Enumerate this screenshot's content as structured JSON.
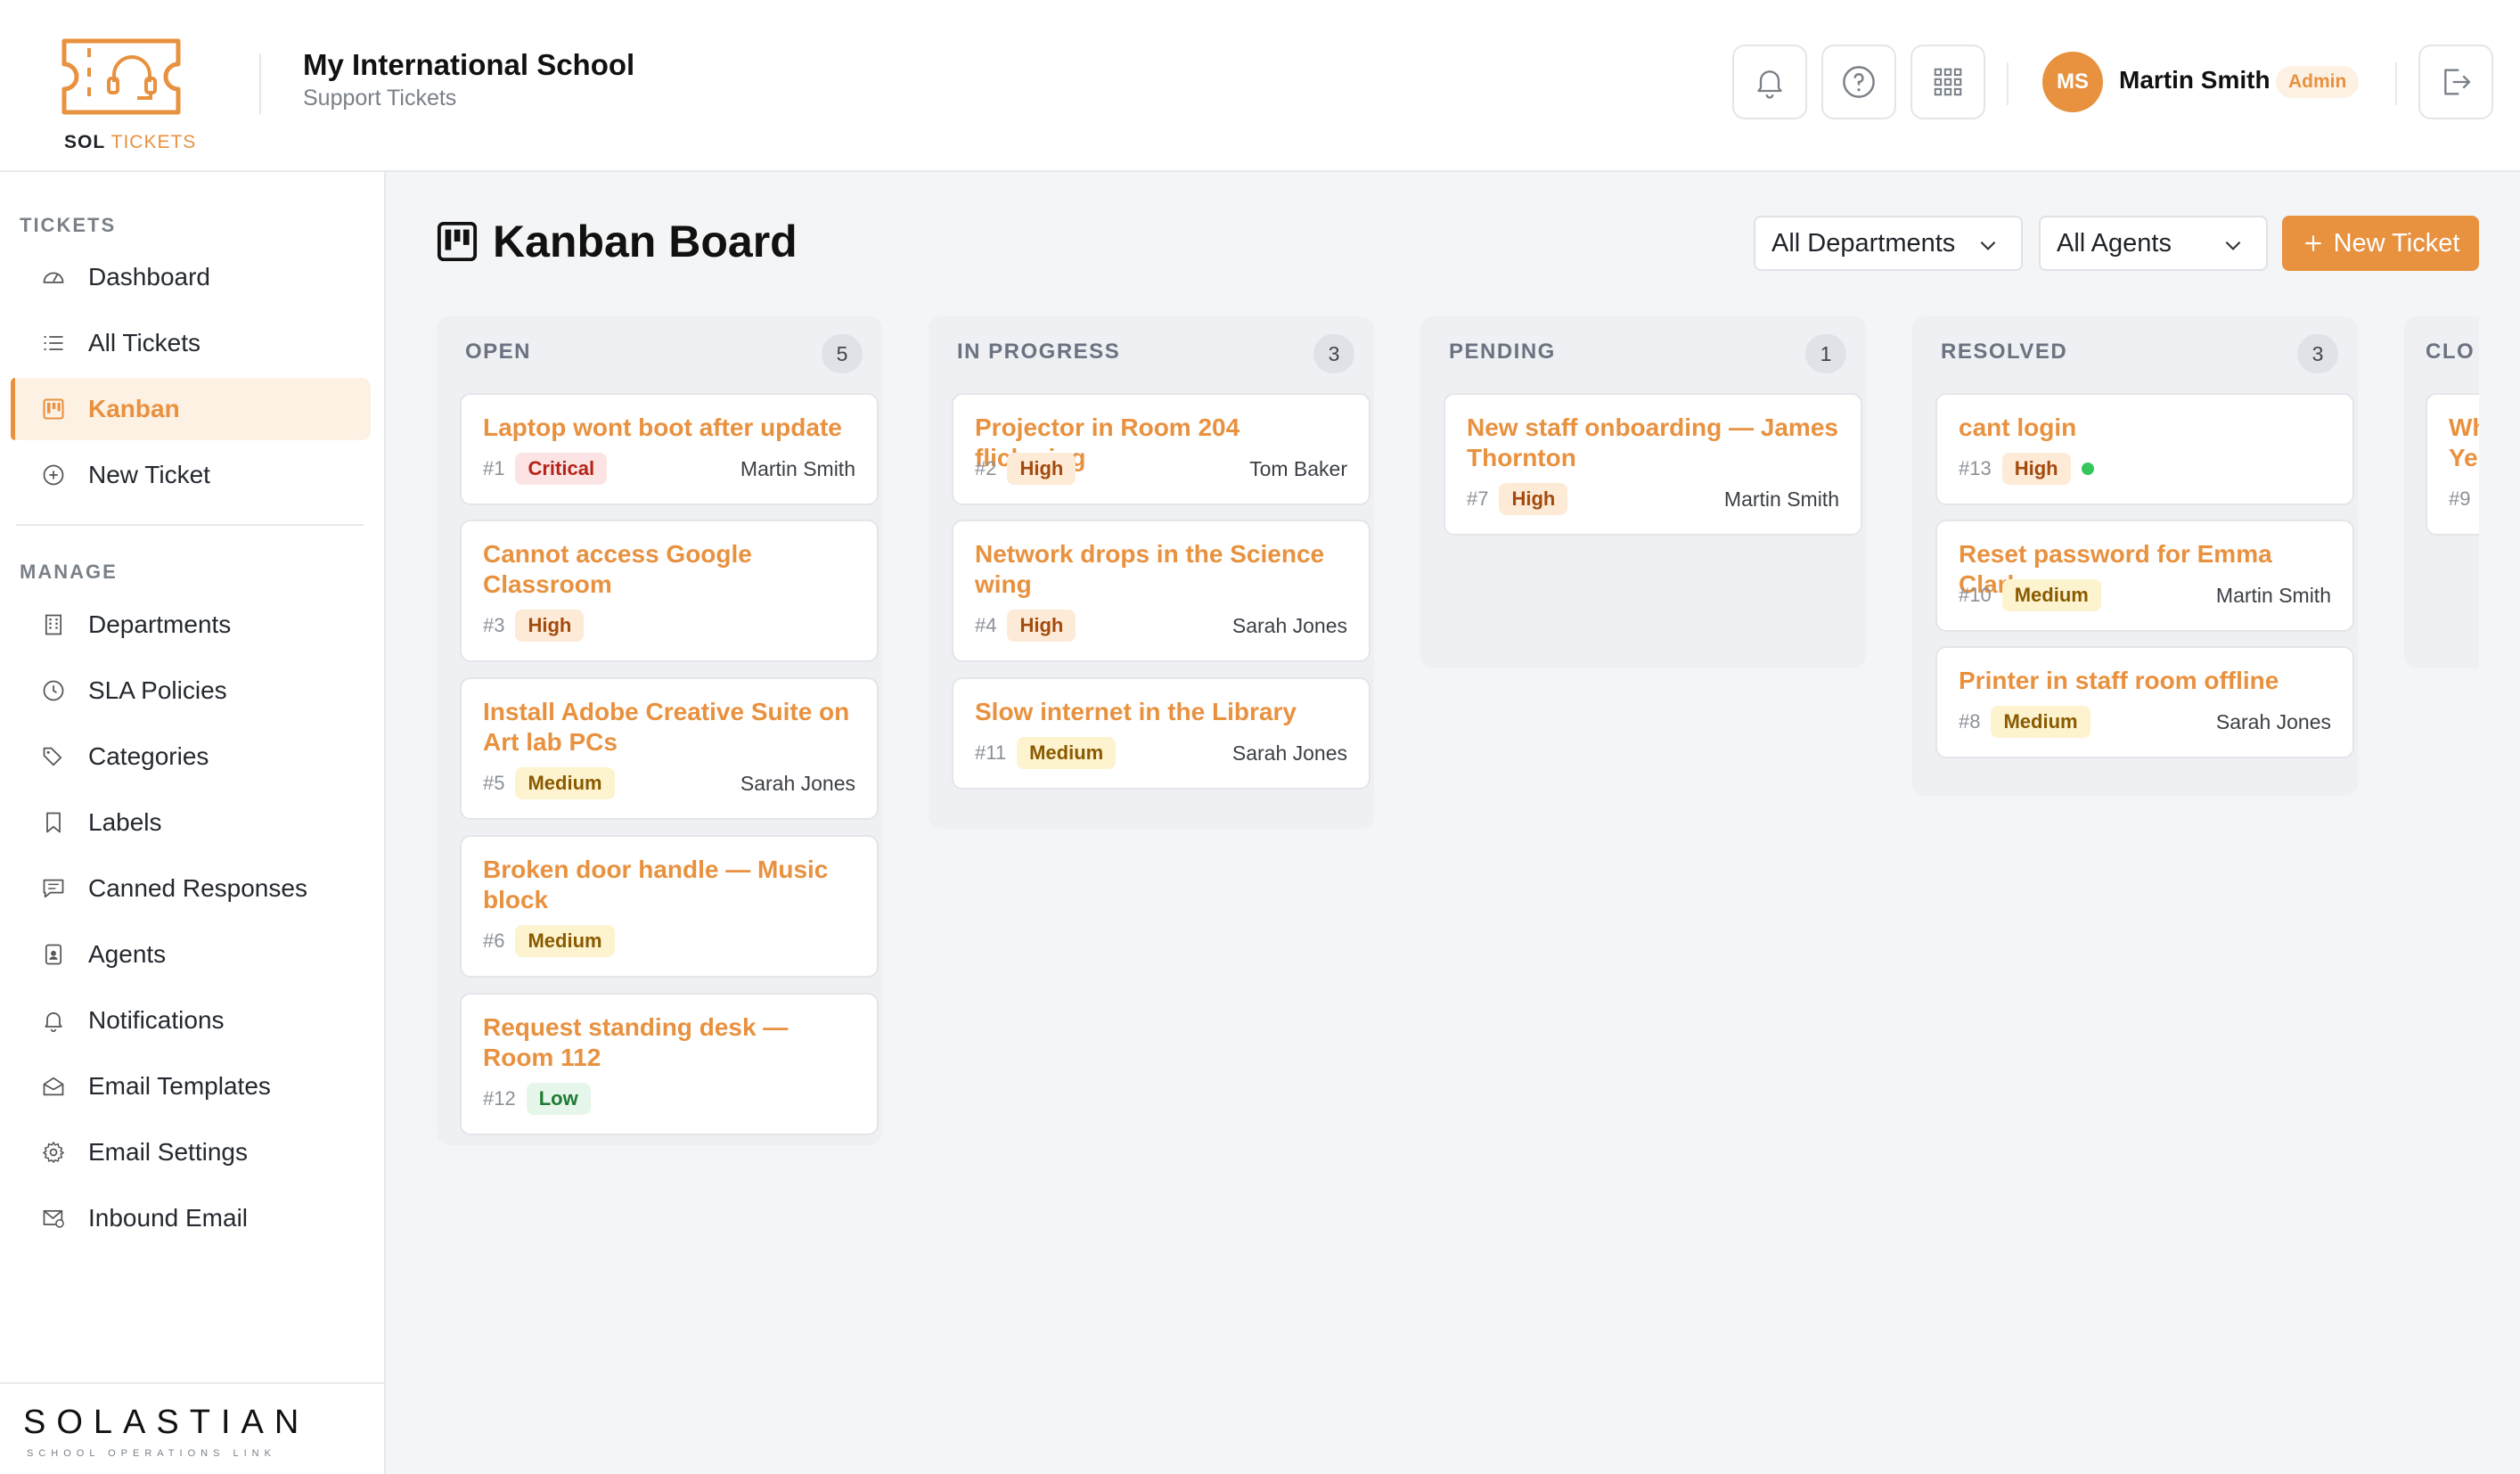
{
  "brand": {
    "logo_text_main": "SOL",
    "logo_text_accent": "TICKETS",
    "footer_name": "SOLASTIAN",
    "footer_tagline": "SCHOOL OPERATIONS LINK"
  },
  "header": {
    "school_name": "My International School",
    "school_subtitle": "Support Tickets",
    "icons": [
      "bell-icon",
      "help-circle-icon",
      "apps-grid-icon",
      "logout-icon"
    ],
    "user": {
      "initials": "MS",
      "name": "Martin Smith",
      "role": "Admin"
    }
  },
  "sidebar": {
    "tickets_label": "TICKETS",
    "manage_label": "MANAGE",
    "ticket_items": [
      {
        "label": "Dashboard",
        "icon": "gauge-icon",
        "active": false
      },
      {
        "label": "All Tickets",
        "icon": "list-icon",
        "active": false
      },
      {
        "label": "Kanban",
        "icon": "kanban-icon",
        "active": true
      },
      {
        "label": "New Ticket",
        "icon": "plus-circle-icon",
        "active": false
      }
    ],
    "manage_items": [
      {
        "label": "Departments",
        "icon": "building-icon"
      },
      {
        "label": "SLA Policies",
        "icon": "clock-icon"
      },
      {
        "label": "Categories",
        "icon": "tags-icon"
      },
      {
        "label": "Labels",
        "icon": "bookmark-icon"
      },
      {
        "label": "Canned Responses",
        "icon": "chat-icon"
      },
      {
        "label": "Agents",
        "icon": "id-badge-icon"
      },
      {
        "label": "Notifications",
        "icon": "bell-icon"
      },
      {
        "label": "Email Templates",
        "icon": "envelope-open-icon"
      },
      {
        "label": "Email Settings",
        "icon": "gear-icon"
      },
      {
        "label": "Inbound Email",
        "icon": "inbox-envelope-icon"
      }
    ]
  },
  "main": {
    "title": "Kanban Board",
    "department_filter": "All Departments",
    "agent_filter": "All Agents",
    "new_ticket_label": "New Ticket",
    "accent_color": "#e8913f"
  },
  "columns": [
    {
      "title": "OPEN",
      "count": "5",
      "cards": [
        {
          "title": "Laptop wont boot after update",
          "id": "#1",
          "priority": "Critical",
          "assignee": "Martin Smith"
        },
        {
          "title": "Cannot access Google Classroom",
          "id": "#3",
          "priority": "High",
          "assignee": ""
        },
        {
          "title": "Install Adobe Creative Suite on Art lab PCs",
          "id": "#5",
          "priority": "Medium",
          "assignee": "Sarah Jones"
        },
        {
          "title": "Broken door handle — Music block",
          "id": "#6",
          "priority": "Medium",
          "assignee": ""
        },
        {
          "title": "Request standing desk — Room 112",
          "id": "#12",
          "priority": "Low",
          "assignee": ""
        }
      ]
    },
    {
      "title": "IN PROGRESS",
      "count": "3",
      "cards": [
        {
          "title": "Projector in Room 204 flickering",
          "id": "#2",
          "priority": "High",
          "assignee": "Tom Baker"
        },
        {
          "title": "Network drops in the Science wing",
          "id": "#4",
          "priority": "High",
          "assignee": "Sarah Jones"
        },
        {
          "title": "Slow internet in the Library",
          "id": "#11",
          "priority": "Medium",
          "assignee": "Sarah Jones"
        }
      ]
    },
    {
      "title": "PENDING",
      "count": "1",
      "cards": [
        {
          "title": "New staff onboarding — James Thornton",
          "id": "#7",
          "priority": "High",
          "assignee": "Martin Smith"
        }
      ]
    },
    {
      "title": "RESOLVED",
      "count": "3",
      "cards": [
        {
          "title": "cant login",
          "id": "#13",
          "priority": "High",
          "assignee": "",
          "online": true
        },
        {
          "title": "Reset password for Emma Clarke",
          "id": "#10",
          "priority": "Medium",
          "assignee": "Martin Smith"
        },
        {
          "title": "Printer in staff room offline",
          "id": "#8",
          "priority": "Medium",
          "assignee": "Sarah Jones"
        }
      ]
    },
    {
      "title": "CLO",
      "count": "",
      "cards": [
        {
          "title": "Wh Ye",
          "id": "#9",
          "priority": "",
          "assignee": ""
        }
      ]
    }
  ]
}
